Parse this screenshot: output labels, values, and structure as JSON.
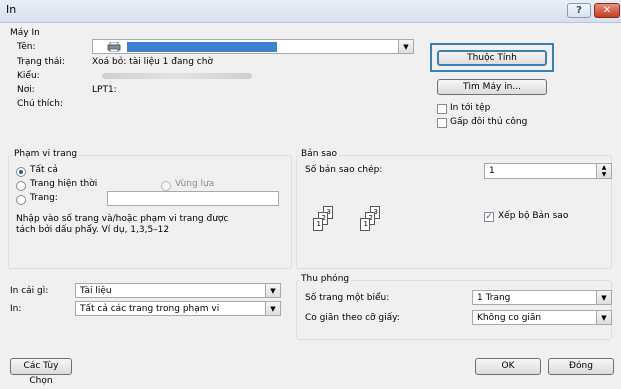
{
  "window": {
    "title": "In"
  },
  "printer": {
    "group_label": "Máy In",
    "name_label": "Tên:",
    "status_label": "Trạng thái:",
    "status_value": "Xoá bỏ: tài liệu 1 đang chờ",
    "type_label": "Kiểu:",
    "where_label": "Nơi:",
    "where_value": "LPT1:",
    "comment_label": "Chú thích:",
    "properties_button": "Thuộc Tính",
    "find_printer_button": "Tìm Máy in...",
    "print_to_file": "In tới tệp",
    "manual_duplex": "Gấp đôi thủ công"
  },
  "page_range": {
    "group_label": "Phạm vi trang",
    "all": "Tất cả",
    "current_page": "Trang hiện thời",
    "selection": "Vùng lựa",
    "pages": "Trang:",
    "pages_value": "",
    "hint": "Nhập vào số trang và/hoặc phạm vi trang được tách bởi dấu phẩy. Ví dụ, 1,3,5–12"
  },
  "copies": {
    "group_label": "Bản sao",
    "count_label": "Số bản sao chép:",
    "count_value": "1",
    "collate": "Xếp bộ Bản sao",
    "page_numbers": [
      "3",
      "2",
      "1",
      "3",
      "2",
      "1"
    ]
  },
  "print_what": {
    "label": "In cái gì:",
    "value": "Tài liệu"
  },
  "print": {
    "label": "In:",
    "value": "Tất cả các trang trong phạm vi"
  },
  "zoom": {
    "group_label": "Thu phóng",
    "pages_per_sheet_label": "Số trang một biểu:",
    "pages_per_sheet_value": "1 Trang",
    "scale_label": "Co giãn theo cỡ giấy:",
    "scale_value": "Không co giãn"
  },
  "footer": {
    "options_button": "Các Tùy Chọn",
    "ok_button": "OK",
    "cancel_button": "Đóng"
  },
  "state": {
    "range_selected": "all",
    "collate_checked": true,
    "print_to_file_checked": false,
    "manual_duplex_checked": false
  },
  "colors": {
    "accent": "#3c7fb1",
    "radio_dot": "#1c5ea8"
  },
  "icons": {
    "printer": "printer-icon",
    "help": "help-icon",
    "close": "close-icon"
  }
}
